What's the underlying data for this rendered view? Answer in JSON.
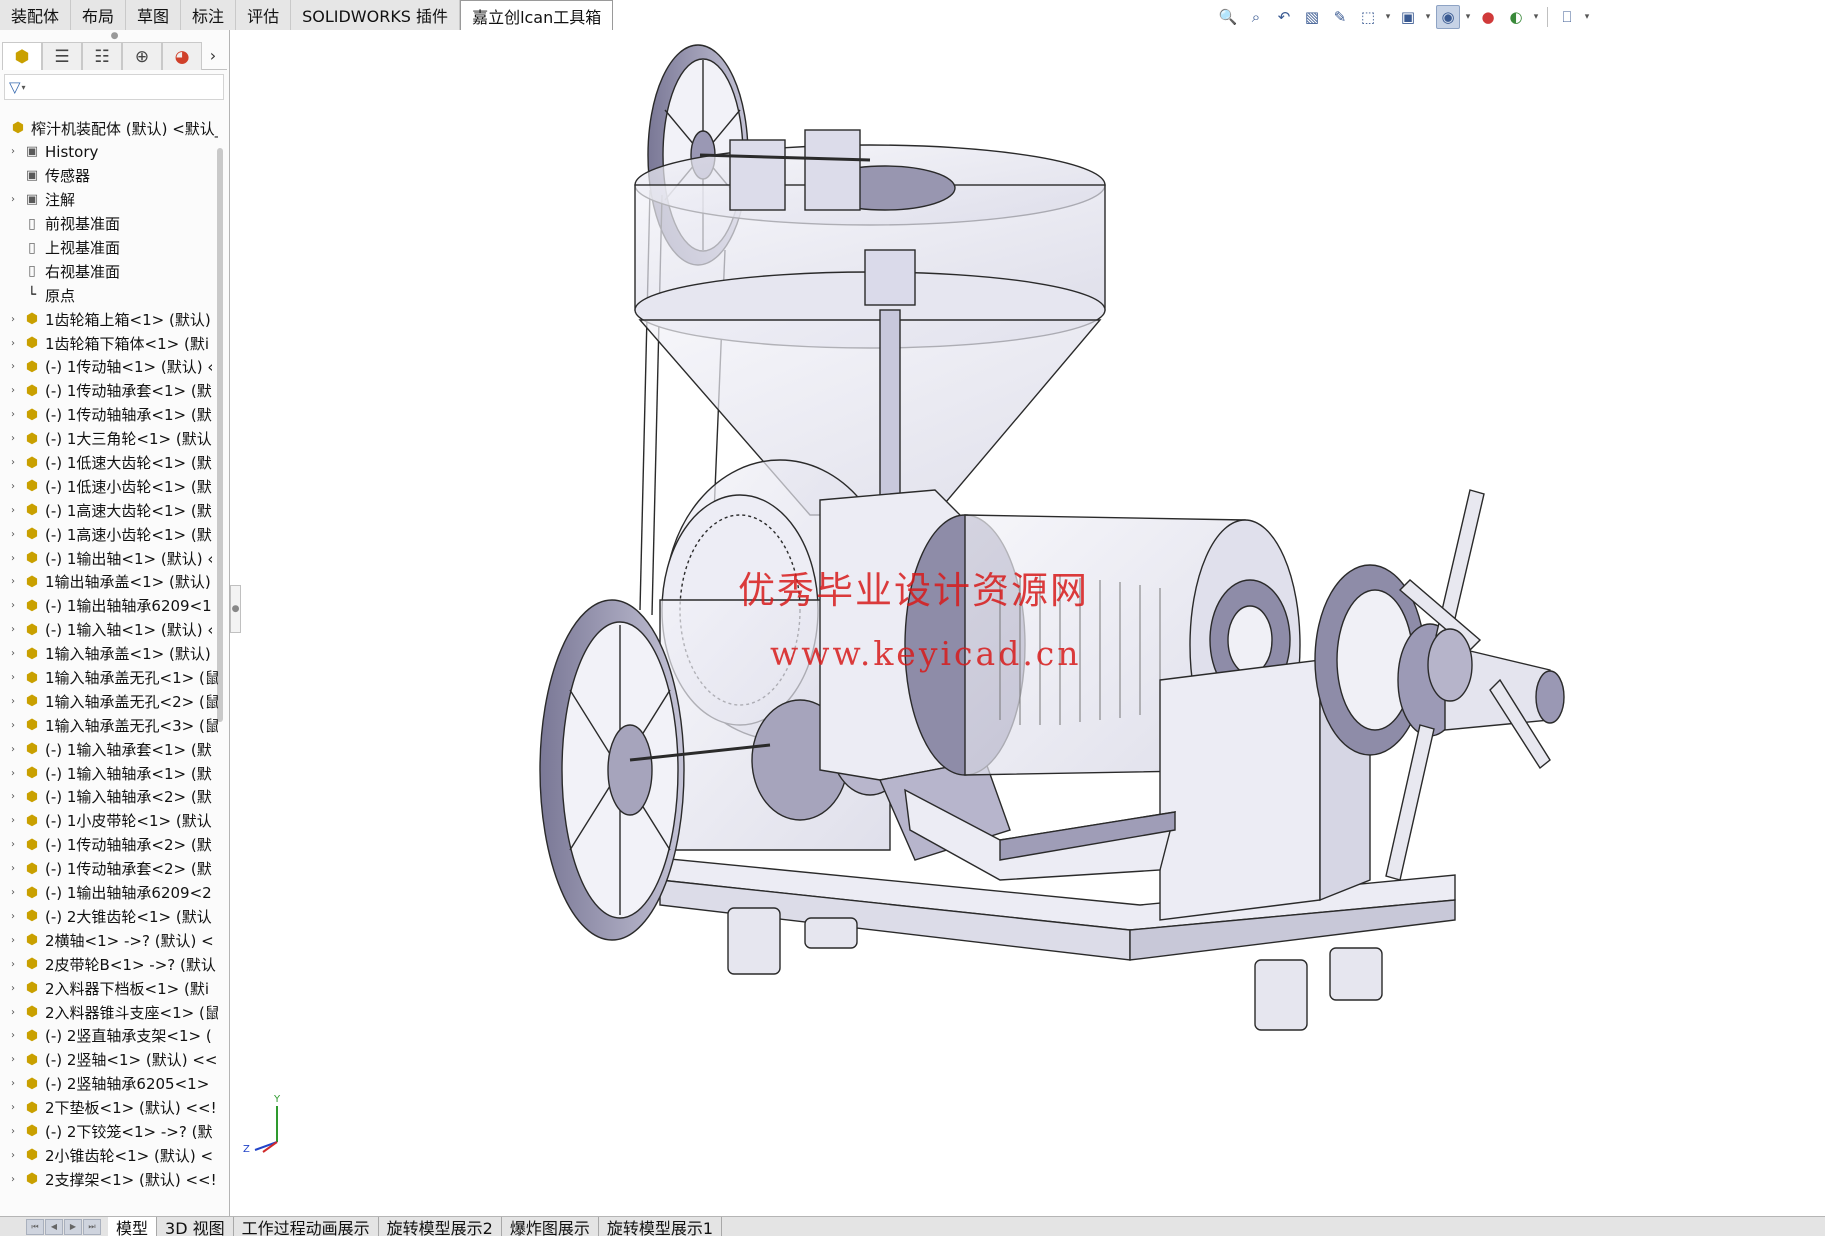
{
  "command_tabs": [
    "装配体",
    "布局",
    "草图",
    "标注",
    "评估",
    "SOLIDWORKS 插件",
    "嘉立创lcan工具箱"
  ],
  "active_command_tab": 6,
  "hud_icons": [
    "zoom-to-fit-icon",
    "zoom-to-area-icon",
    "previous-view-icon",
    "section-view-icon",
    "dynamic-annotation-icon",
    "view-orientation-icon",
    "display-style-icon",
    "hide-show-items-icon",
    "edit-appearance-icon",
    "apply-scene-icon",
    "view-settings-icon",
    "monitor-icon"
  ],
  "manager_tabs": [
    "featuremanager-icon",
    "propertymanager-icon",
    "configurationmanager-icon",
    "dimxpert-icon",
    "display-manager-icon"
  ],
  "tree": {
    "root": "榨汁机装配体 (默认) <默认_",
    "items": [
      {
        "label": "History",
        "icon": "folder",
        "expand": true
      },
      {
        "label": "传感器",
        "icon": "folder",
        "expand": false
      },
      {
        "label": "注解",
        "icon": "folder",
        "expand": true
      },
      {
        "label": "前视基准面",
        "icon": "plane",
        "expand": false
      },
      {
        "label": "上视基准面",
        "icon": "plane",
        "expand": false
      },
      {
        "label": "右视基准面",
        "icon": "plane",
        "expand": false
      },
      {
        "label": "原点",
        "icon": "origin",
        "expand": false
      },
      {
        "label": "1齿轮箱上箱<1> (默认)",
        "icon": "part",
        "expand": true
      },
      {
        "label": "1齿轮箱下箱体<1> (默i",
        "icon": "part",
        "expand": true
      },
      {
        "label": "(-) 1传动轴<1> (默认) ‹",
        "icon": "part",
        "expand": true
      },
      {
        "label": "(-) 1传动轴承套<1> (默",
        "icon": "part",
        "expand": true
      },
      {
        "label": "(-) 1传动轴轴承<1> (默",
        "icon": "part",
        "expand": true
      },
      {
        "label": "(-) 1大三角轮<1> (默认",
        "icon": "part",
        "expand": true
      },
      {
        "label": "(-) 1低速大齿轮<1> (默",
        "icon": "part",
        "expand": true
      },
      {
        "label": "(-) 1低速小齿轮<1> (默",
        "icon": "part",
        "expand": true
      },
      {
        "label": "(-) 1高速大齿轮<1> (默",
        "icon": "part",
        "expand": true
      },
      {
        "label": "(-) 1高速小齿轮<1> (默",
        "icon": "part",
        "expand": true
      },
      {
        "label": "(-) 1输出轴<1> (默认) ‹",
        "icon": "part",
        "expand": true
      },
      {
        "label": "1输出轴承盖<1> (默认)",
        "icon": "part",
        "expand": true
      },
      {
        "label": "(-) 1输出轴轴承6209<1",
        "icon": "part",
        "expand": true
      },
      {
        "label": "(-) 1输入轴<1> (默认) ‹",
        "icon": "part",
        "expand": true
      },
      {
        "label": "1输入轴承盖<1> (默认)",
        "icon": "part",
        "expand": true
      },
      {
        "label": "1输入轴承盖无孔<1> (鼠",
        "icon": "part",
        "expand": true
      },
      {
        "label": "1输入轴承盖无孔<2> (鼠",
        "icon": "part",
        "expand": true
      },
      {
        "label": "1输入轴承盖无孔<3> (鼠",
        "icon": "part",
        "expand": true
      },
      {
        "label": "(-) 1输入轴承套<1> (默",
        "icon": "part",
        "expand": true
      },
      {
        "label": "(-) 1输入轴轴承<1> (默",
        "icon": "part",
        "expand": true
      },
      {
        "label": "(-) 1输入轴轴承<2> (默",
        "icon": "part",
        "expand": true
      },
      {
        "label": "(-) 1小皮带轮<1> (默认",
        "icon": "part",
        "expand": true
      },
      {
        "label": "(-) 1传动轴轴承<2> (默",
        "icon": "part",
        "expand": true
      },
      {
        "label": "(-) 1传动轴承套<2> (默",
        "icon": "part",
        "expand": true
      },
      {
        "label": "(-) 1输出轴轴承6209<2",
        "icon": "part",
        "expand": true
      },
      {
        "label": "(-) 2大锥齿轮<1> (默认",
        "icon": "part",
        "expand": true
      },
      {
        "label": "2横轴<1> ->? (默认) <",
        "icon": "part",
        "expand": true
      },
      {
        "label": "2皮带轮B<1> ->? (默认",
        "icon": "part",
        "expand": true
      },
      {
        "label": "2入料器下档板<1> (默i",
        "icon": "part",
        "expand": true
      },
      {
        "label": "2入料器锥斗支座<1> (鼠",
        "icon": "part",
        "expand": true
      },
      {
        "label": "(-) 2竖直轴承支架<1> (",
        "icon": "part",
        "expand": true
      },
      {
        "label": "(-) 2竖轴<1> (默认) <<",
        "icon": "part",
        "expand": true
      },
      {
        "label": "(-) 2竖轴轴承6205<1>",
        "icon": "part",
        "expand": true
      },
      {
        "label": "2下垫板<1> (默认) <<!",
        "icon": "part",
        "expand": true
      },
      {
        "label": "(-) 2下铰笼<1> ->? (默",
        "icon": "part",
        "expand": true
      },
      {
        "label": "2小锥齿轮<1> (默认) <",
        "icon": "part",
        "expand": true
      },
      {
        "label": "2支撑架<1> (默认) <<!",
        "icon": "part",
        "expand": true
      }
    ]
  },
  "watermark": {
    "line1": "优秀毕业设计资源网",
    "line2": "www.keyicad.cn"
  },
  "triad": {
    "x": "X",
    "y": "Y",
    "z": "Z"
  },
  "bottom_tabs": [
    "模型",
    "3D 视图",
    "工作过程动画展示",
    "旋转模型展示2",
    "爆炸图展示",
    "旋转模型展示1"
  ],
  "active_bottom_tab": 0,
  "colors": {
    "watermark": "#d81b1b",
    "model_edge": "#2a2a2a",
    "model_fill": "#ececf4",
    "model_shade": "#8c8aa6"
  }
}
